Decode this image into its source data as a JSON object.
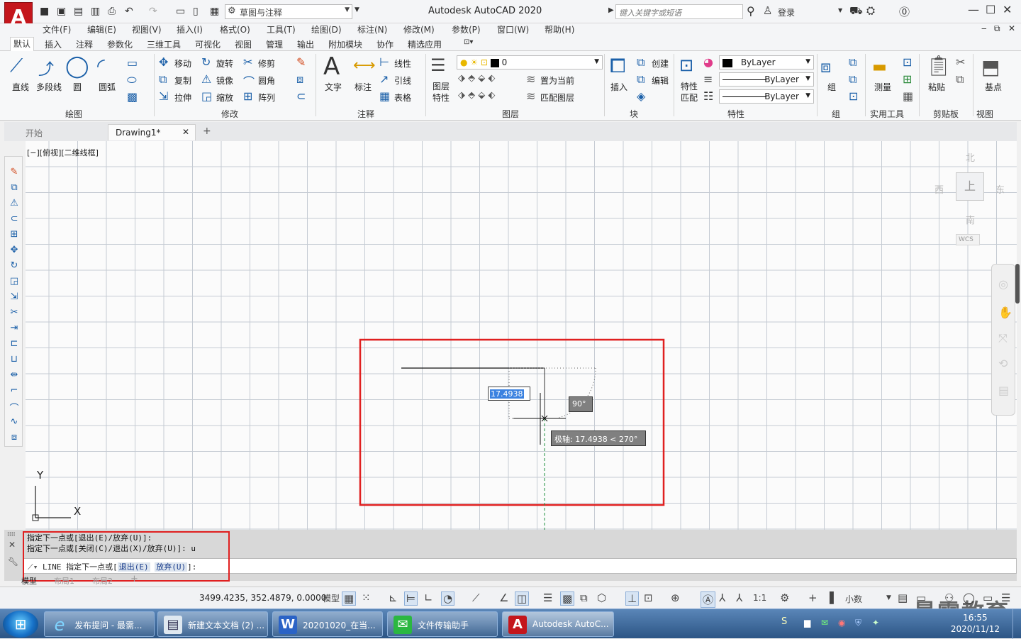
{
  "window": {
    "title": "Autodesk AutoCAD 2020",
    "app_logo": "A",
    "workspace": "草图与注释",
    "search_placeholder": "键入关键字或短语",
    "login": "登录"
  },
  "menubar": [
    "文件(F)",
    "编辑(E)",
    "视图(V)",
    "插入(I)",
    "格式(O)",
    "工具(T)",
    "绘图(D)",
    "标注(N)",
    "修改(M)",
    "参数(P)",
    "窗口(W)",
    "帮助(H)"
  ],
  "ribbon_tabs": [
    "默认",
    "插入",
    "注释",
    "参数化",
    "三维工具",
    "可视化",
    "视图",
    "管理",
    "输出",
    "附加模块",
    "协作",
    "精选应用"
  ],
  "ribbon": {
    "draw": {
      "title": "绘图",
      "items": [
        "直线",
        "多段线",
        "圆",
        "圆弧"
      ]
    },
    "modify": {
      "title": "修改",
      "items": [
        "移动",
        "旋转",
        "修剪",
        "复制",
        "镜像",
        "圆角",
        "拉伸",
        "缩放",
        "阵列"
      ]
    },
    "annotation": {
      "title": "注释",
      "items": [
        "文字",
        "标注",
        "线性",
        "引线",
        "表格"
      ]
    },
    "layers": {
      "title": "图层",
      "items": [
        "图层特性",
        "置为当前",
        "匹配图层"
      ],
      "current_layer": "0"
    },
    "block": {
      "title": "块",
      "items": [
        "插入",
        "创建",
        "编辑"
      ]
    },
    "properties": {
      "title": "特性",
      "items": [
        "特性匹配"
      ],
      "color": "ByLayer",
      "linetype": "ByLayer",
      "lineweight": "ByLayer"
    },
    "groups": {
      "title": "组",
      "items": [
        "组"
      ]
    },
    "utilities": {
      "title": "实用工具",
      "items": [
        "测量"
      ]
    },
    "clipboard": {
      "title": "剪贴板",
      "items": [
        "粘贴"
      ]
    },
    "view": {
      "title": "视图",
      "items": [
        "基点"
      ]
    }
  },
  "doc_tabs": [
    "开始",
    "Drawing1*"
  ],
  "viewport": {
    "label": "[−][俯视][二维线框]",
    "viewcube": {
      "north": "北",
      "south": "南",
      "east": "东",
      "west": "西",
      "top": "上",
      "wcs": "WCS"
    },
    "ucs": {
      "x": "X",
      "y": "Y"
    },
    "dynamic_input": "17.4938",
    "angle_tooltip": "90°",
    "polar_tooltip": "极轴: 17.4938 < 270°"
  },
  "command": {
    "history": [
      "指定下一点或[退出(E)/放弃(U)]:",
      "指定下一点或[关闭(C)/退出(X)/放弃(U)]: u"
    ],
    "prompt_prefix": "LINE 指定下一点或[",
    "option1": "退出(E)",
    "option2": "放弃(U)",
    "prompt_suffix": "]:"
  },
  "layout_tabs": [
    "模型",
    "布局1",
    "布局2"
  ],
  "status": {
    "coords": "3499.4235, 352.4879, 0.0000",
    "model": "模型",
    "scale": "1:1",
    "units": "小数"
  },
  "taskbar": {
    "tasks": [
      "发布提问 - 最需...",
      "新建文本文档 (2) ...",
      "20201020_在当...",
      "文件传输助手",
      "Autodesk AutoC..."
    ],
    "time": "16:55",
    "date": "2020/11/12"
  },
  "watermark": "最需教育",
  "colors": {
    "highlight_box": "#e02020",
    "accent": "#1a5fa8",
    "logo": "#c4161c"
  }
}
